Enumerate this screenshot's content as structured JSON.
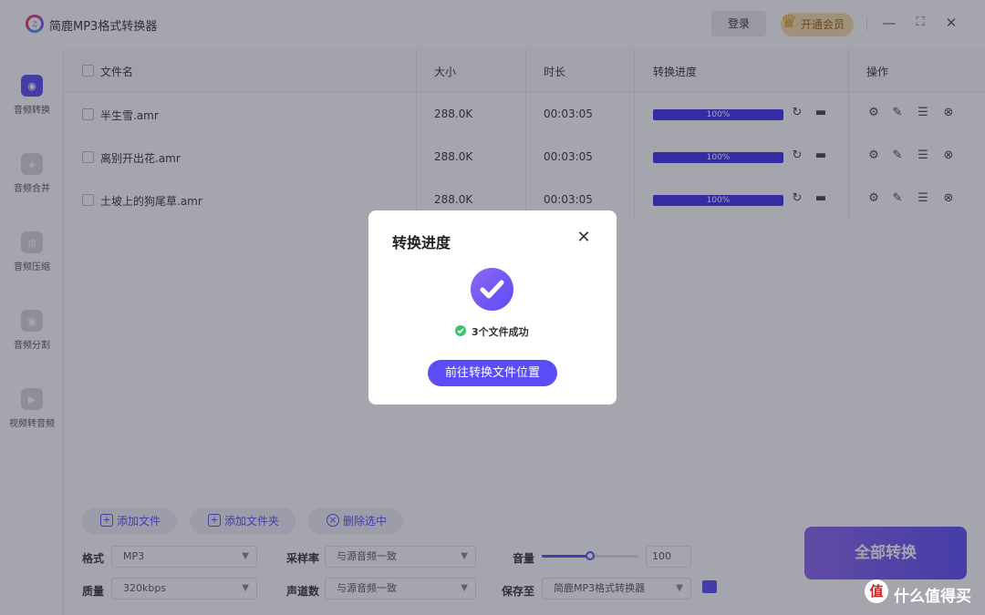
{
  "app": {
    "title": "简鹿MP3格式转换器",
    "login_label": "登录",
    "vip_label": "开通会员"
  },
  "window_controls": {
    "minimize": "—",
    "maximize": "⛶",
    "close": "✕"
  },
  "sidebar": {
    "items": [
      {
        "label": "音频转换",
        "active": true,
        "icon": "audio-convert-icon"
      },
      {
        "label": "音频合并",
        "active": false,
        "icon": "audio-merge-icon"
      },
      {
        "label": "音频压缩",
        "active": false,
        "icon": "audio-compress-icon"
      },
      {
        "label": "音频分割",
        "active": false,
        "icon": "audio-split-icon"
      },
      {
        "label": "视频转音频",
        "active": false,
        "icon": "video-to-audio-icon"
      }
    ]
  },
  "table": {
    "headers": {
      "name": "文件名",
      "size": "大小",
      "duration": "时长",
      "progress": "转换进度",
      "actions": "操作"
    },
    "rows": [
      {
        "name": "半生雪.amr",
        "size": "288.0K",
        "duration": "00:03:05",
        "progress_label": "100%",
        "progress": 1.0
      },
      {
        "name": "离别开出花.amr",
        "size": "288.0K",
        "duration": "00:03:05",
        "progress_label": "100%",
        "progress": 1.0
      },
      {
        "name": "土坡上的狗尾草.amr",
        "size": "288.0K",
        "duration": "00:03:05",
        "progress_label": "100%",
        "progress": 1.0
      }
    ]
  },
  "bottom": {
    "add_file": "添加文件",
    "add_folder": "添加文件夹",
    "delete_selected": "删除选中",
    "format_label": "格式",
    "format_value": "MP3",
    "sample_rate_label": "采样率",
    "sample_rate_value": "与源音频一致",
    "volume_label": "音量",
    "volume_value": "100",
    "volume_level": 0.5,
    "quality_label": "质量",
    "quality_value": "320kbps",
    "channels_label": "声道数",
    "channels_value": "与源音频一致",
    "save_to_label": "保存至",
    "save_to_value": "简鹿MP3格式转换器",
    "convert_all": "全部转换"
  },
  "modal": {
    "title": "转换进度",
    "close": "✕",
    "success_message": "3个文件成功",
    "goto_button": "前往转换文件位置"
  },
  "watermark": {
    "badge": "值",
    "text": "什么值得买"
  },
  "colors": {
    "accent": "#5b4cf5",
    "success": "#3fc26b"
  }
}
